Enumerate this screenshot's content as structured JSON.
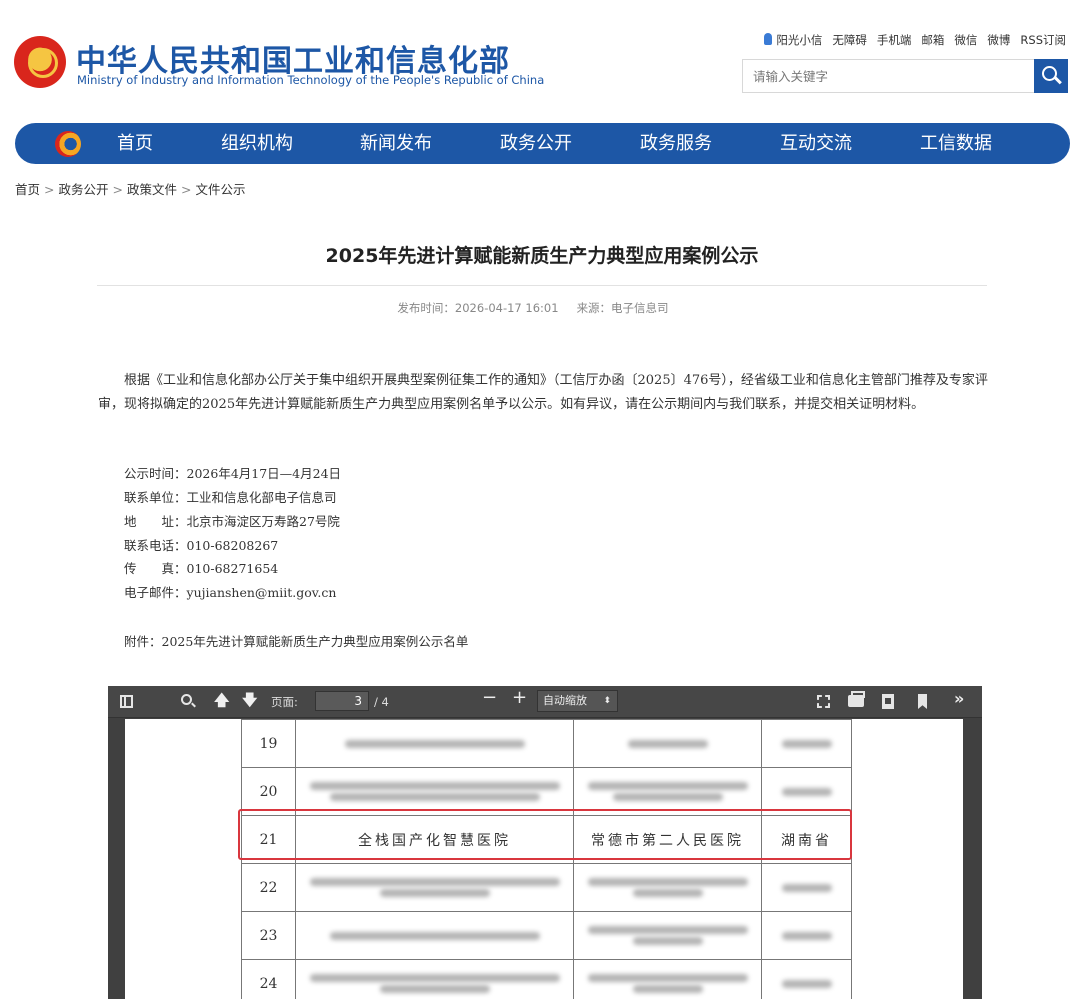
{
  "header": {
    "title": "中华人民共和国工业和信息化部",
    "subtitle": "Ministry of Industry and Information Technology of the People's Republic of China",
    "top_links": [
      "阳光小信",
      "无障碍",
      "手机端",
      "邮箱",
      "微信",
      "微博",
      "RSS订阅"
    ],
    "search_placeholder": "请输入关键字"
  },
  "nav": {
    "items": [
      "首页",
      "组织机构",
      "新闻发布",
      "政务公开",
      "政务服务",
      "互动交流",
      "工信数据"
    ]
  },
  "breadcrumb": [
    "首页",
    "政务公开",
    "政策文件",
    "文件公示"
  ],
  "article": {
    "title": "2025年先进计算赋能新质生产力典型应用案例公示",
    "publish_time": "发布时间：2026-04-17 16:01",
    "source": "来源：电子信息司",
    "paragraph": "根据《工业和信息化部办公厅关于集中组织开展典型案例征集工作的通知》（工信厅办函〔2025〕476号），经省级工业和信息化主管部门推荐及专家评审，现将拟确定的2025年先进计算赋能新质生产力典型应用案例名单予以公示。如有异议，请在公示期间内与我们联系，并提交相关证明材料。",
    "info": [
      {
        "label": "公示时间：",
        "value": "2026年4月17日—4月24日"
      },
      {
        "label": "联系单位：",
        "value": "工业和信息化部电子信息司"
      },
      {
        "label": "地　　址：",
        "value": "北京市海淀区万寿路27号院"
      },
      {
        "label": "联系电话：",
        "value": "010-68208267"
      },
      {
        "label": "传　　真：",
        "value": "010-68271654"
      },
      {
        "label": "电子邮件：",
        "value": "yujianshen@miit.gov.cn"
      }
    ],
    "attachment": "附件：2025年先进计算赋能新质生产力典型应用案例公示名单"
  },
  "pdf_viewer": {
    "page_label": "页面:",
    "current_page": "3",
    "page_total": "/ 4",
    "zoom": "自动缩放",
    "rows": [
      {
        "num": "19",
        "name": "",
        "unit": "",
        "province": ""
      },
      {
        "num": "20",
        "name": "",
        "unit": "",
        "province": ""
      },
      {
        "num": "21",
        "name": "全栈国产化智慧医院",
        "unit": "常德市第二人民医院",
        "province": "湖南省"
      },
      {
        "num": "22",
        "name": "",
        "unit": "",
        "province": ""
      },
      {
        "num": "23",
        "name": "",
        "unit": "",
        "province": ""
      },
      {
        "num": "24",
        "name": "",
        "unit": "",
        "province": ""
      }
    ]
  },
  "colors": {
    "brand_blue": "#1d57a6",
    "highlight_red": "#d9363e",
    "toolbar_dark": "#474747"
  }
}
